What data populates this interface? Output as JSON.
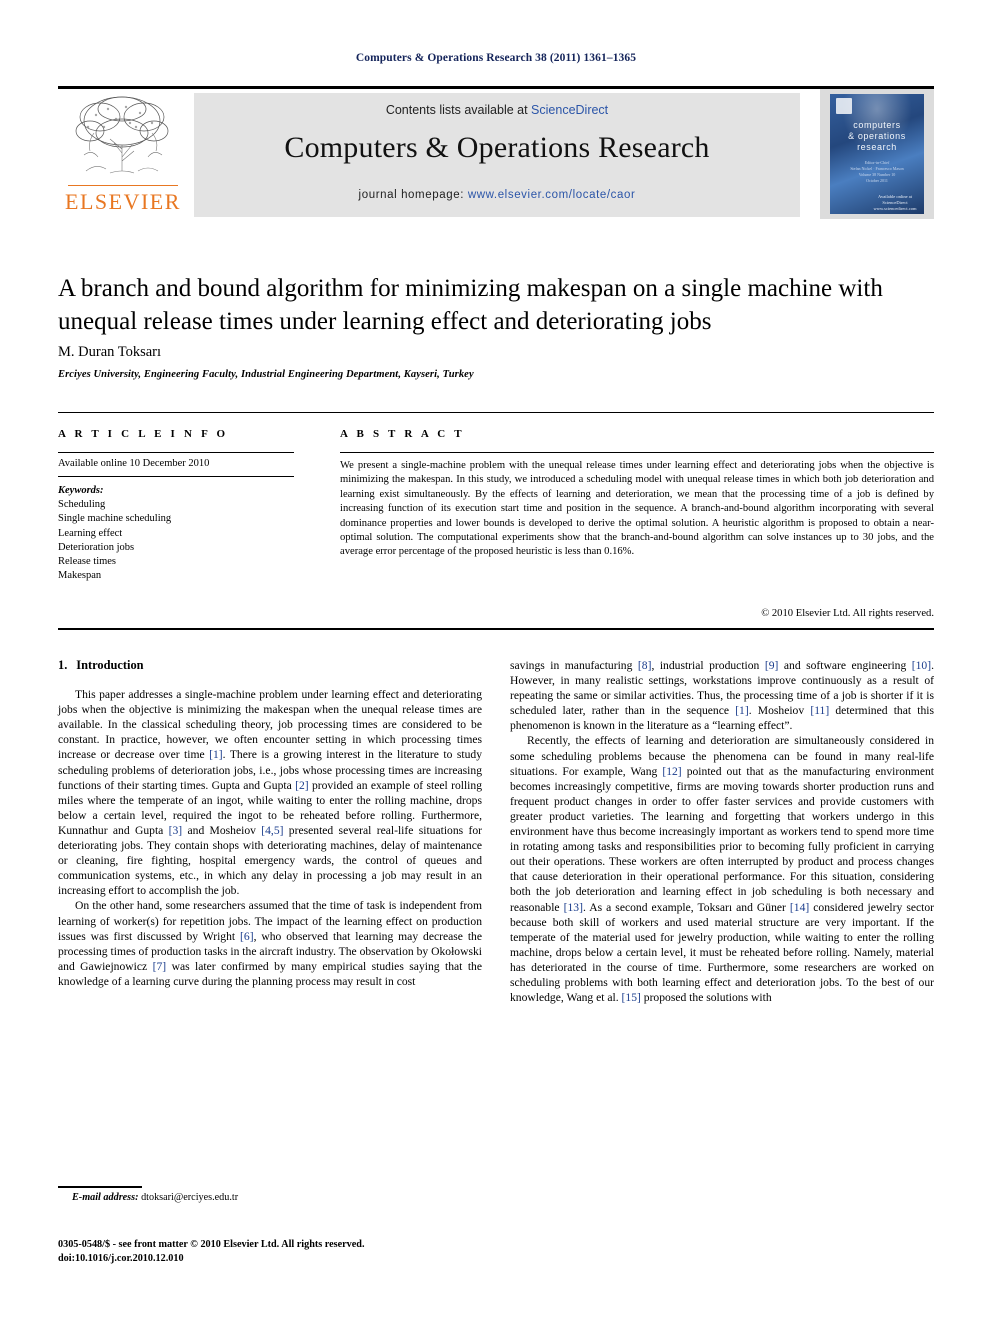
{
  "running_head": "Computers & Operations Research 38 (2011) 1361–1365",
  "masthead": {
    "contents_prefix": "Contents lists available at ",
    "contents_link": "ScienceDirect",
    "journal_title": "Computers & Operations Research",
    "homepage_prefix": "journal homepage: ",
    "homepage_url": "www.elsevier.com/locate/caor",
    "publisher_name": "ELSEVIER",
    "accent_orange": "#e87722",
    "link_blue": "#2b55a8",
    "band_gray": "#e3e3e3"
  },
  "cover": {
    "line1": "computers",
    "line2": "& operations",
    "line3": "research",
    "editors": "Editor-in-Chief\nStefan Nickel · Francesco Mason\nVolume 38 Number 10\nOctober 2011",
    "science_direct": "Available online at\nScienceDirect\nwww.sciencedirect.com"
  },
  "article": {
    "title": "A branch and bound algorithm for minimizing makespan on a single machine with unequal release times under learning effect and deteriorating jobs",
    "authors": "M. Duran Toksarı",
    "affiliation": "Erciyes University, Engineering Faculty, Industrial Engineering Department, Kayseri, Turkey"
  },
  "article_info": {
    "heading": "A R T I C L E   I N F O",
    "history": "Available online 10 December 2010",
    "keywords_label": "Keywords:",
    "keywords": [
      "Scheduling",
      "Single machine scheduling",
      "Learning effect",
      "Deterioration jobs",
      "Release times",
      "Makespan"
    ]
  },
  "abstract": {
    "heading": "A B S T R A C T",
    "text": "We present a single-machine problem with the unequal release times under learning effect and deteriorating jobs when the objective is minimizing the makespan. In this study, we introduced a scheduling model with unequal release times in which both job deterioration and learning exist simultaneously. By the effects of learning and deterioration, we mean that the processing time of a job is defined by increasing function of its execution start time and position in the sequence. A branch-and-bound algorithm incorporating with several dominance properties and lower bounds is developed to derive the optimal solution. A heuristic algorithm is proposed to obtain a near-optimal solution. The computational experiments show that the branch-and-bound algorithm can solve instances up to 30 jobs, and the average error percentage of the proposed heuristic is less than 0.16%.",
    "copyright": "© 2010 Elsevier Ltd. All rights reserved."
  },
  "body": {
    "section_number": "1.",
    "section_title": "Introduction",
    "left_paragraphs": [
      "This paper addresses a single-machine problem under learning effect and deteriorating jobs when the objective is minimizing the makespan when the unequal release times are available. In the classical scheduling theory, job processing times are considered to be constant. In practice, however, we often encounter setting in which processing times increase or decrease over time [1]. There is a growing interest in the literature to study scheduling problems of deterioration jobs, i.e., jobs whose processing times are increasing functions of their starting times. Gupta and Gupta [2] provided an example of steel rolling miles where the temperate of an ingot, while waiting to enter the rolling machine, drops below a certain level, required the ingot to be reheated before rolling. Furthermore, Kunnathur and Gupta [3] and Mosheiov [4,5] presented several real-life situations for deteriorating jobs. They contain shops with deteriorating machines, delay of maintenance or cleaning, fire fighting, hospital emergency wards, the control of queues and communication systems, etc., in which any delay in processing a job may result in an increasing effort to accomplish the job.",
      "On the other hand, some researchers assumed that the time of task is independent from learning of worker(s) for repetition jobs. The impact of the learning effect on production issues was first discussed by Wright [6], who observed that learning may decrease the processing times of production tasks in the aircraft industry. The observation by Okołowski and Gawiejnowicz [7] was later confirmed by many empirical studies saying that the knowledge of a learning curve during the planning process may result in cost"
    ],
    "right_paragraphs": [
      "savings in manufacturing [8], industrial production [9] and software engineering [10]. However, in many realistic settings, workstations improve continuously as a result of repeating the same or similar activities. Thus, the processing time of a job is shorter if it is scheduled later, rather than in the sequence [1]. Mosheiov [11] determined that this phenomenon is known in the literature as a “learning effect”.",
      "Recently, the effects of learning and deterioration are simultaneously considered in some scheduling problems because the phenomena can be found in many real-life situations. For example, Wang [12] pointed out that as the manufacturing environment becomes increasingly competitive, firms are moving towards shorter production runs and frequent product changes in order to offer faster services and provide customers with greater product varieties. The learning and forgetting that workers undergo in this environment have thus become increasingly important as workers tend to spend more time in rotating among tasks and responsibilities prior to becoming fully proficient in carrying out their operations. These workers are often interrupted by product and process changes that cause deterioration in their operational performance. For this situation, considering both the job deterioration and learning effect in job scheduling is both necessary and reasonable [13]. As a second example, Toksarı and Güner [14] considered jewelry sector because both skill of workers and used material structure are very important. If the temperate of the material used for jewelry production, while waiting to enter the rolling machine, drops below a certain level, it must be reheated before rolling. Namely, material has deteriorated in the course of time. Furthermore, some researchers are worked on scheduling problems with both learning effect and deterioration jobs. To the best of our knowledge, Wang et al. [15] proposed the solutions with"
    ]
  },
  "footer": {
    "email_label": "E-mail address:",
    "email": "dtoksari@erciyes.edu.tr",
    "issn_line": "0305-0548/$ - see front matter © 2010 Elsevier Ltd. All rights reserved.",
    "doi_line": "doi:10.1016/j.cor.2010.12.010"
  }
}
